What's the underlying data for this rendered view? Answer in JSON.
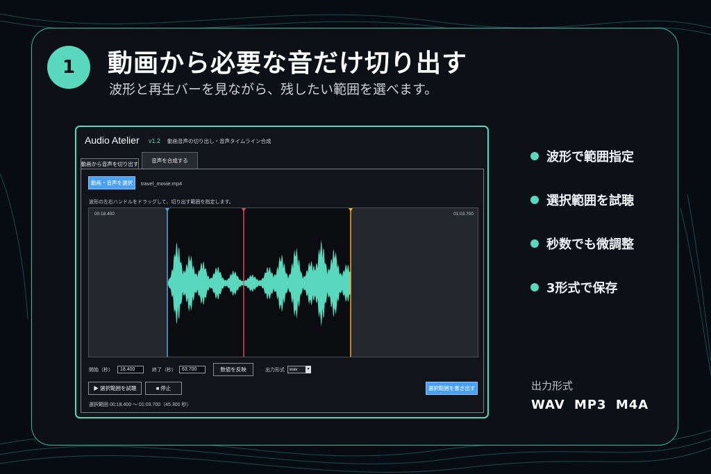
{
  "step_number": "1",
  "title": "動画から必要な音だけ切り出す",
  "subtitle": "波形と再生バーを見ながら、残したい範囲を選べます。",
  "app": {
    "name": "Audio Atelier",
    "version": "v1.2",
    "tagline": "動画音声の切り出し・音声タイムライン合成",
    "tabs": [
      "動画から音声を切り出す",
      "音声を合成する"
    ],
    "select_media_button": "動画・音声を選択",
    "file_name": "travel_movie.mp4",
    "instruction": "波形の左右ハンドルをドラッグして、切り出す範囲を指定します。",
    "start_time_marker": "00:18.400",
    "end_time_marker": "01:03.700",
    "start_label": "開始（秒）",
    "start_value": "18.400",
    "end_label": "終了（秒）",
    "end_value": "63.700",
    "apply_button": "数値を反映",
    "format_label": "出力形式",
    "format_value": "wav",
    "preview_button": "▶ 選択範囲を試聴",
    "stop_button": "■ 停止",
    "export_button": "選択範囲を書き出す",
    "range_status": "選択範囲 00:18.400 〜 01:03.700（45.300 秒）",
    "colors": {
      "start_handle": "#5aa3ef",
      "playhead": "#e8485c",
      "end_handle": "#efae3f",
      "waveform": "#5ad8bd"
    }
  },
  "features": [
    "波形で範囲指定",
    "選択範囲を試聴",
    "秒数でも微調整",
    "3形式で保存"
  ],
  "output_formats_label": "出力形式",
  "output_formats": "WAV  MP3  M4A",
  "accent_color": "#5ad8bd"
}
